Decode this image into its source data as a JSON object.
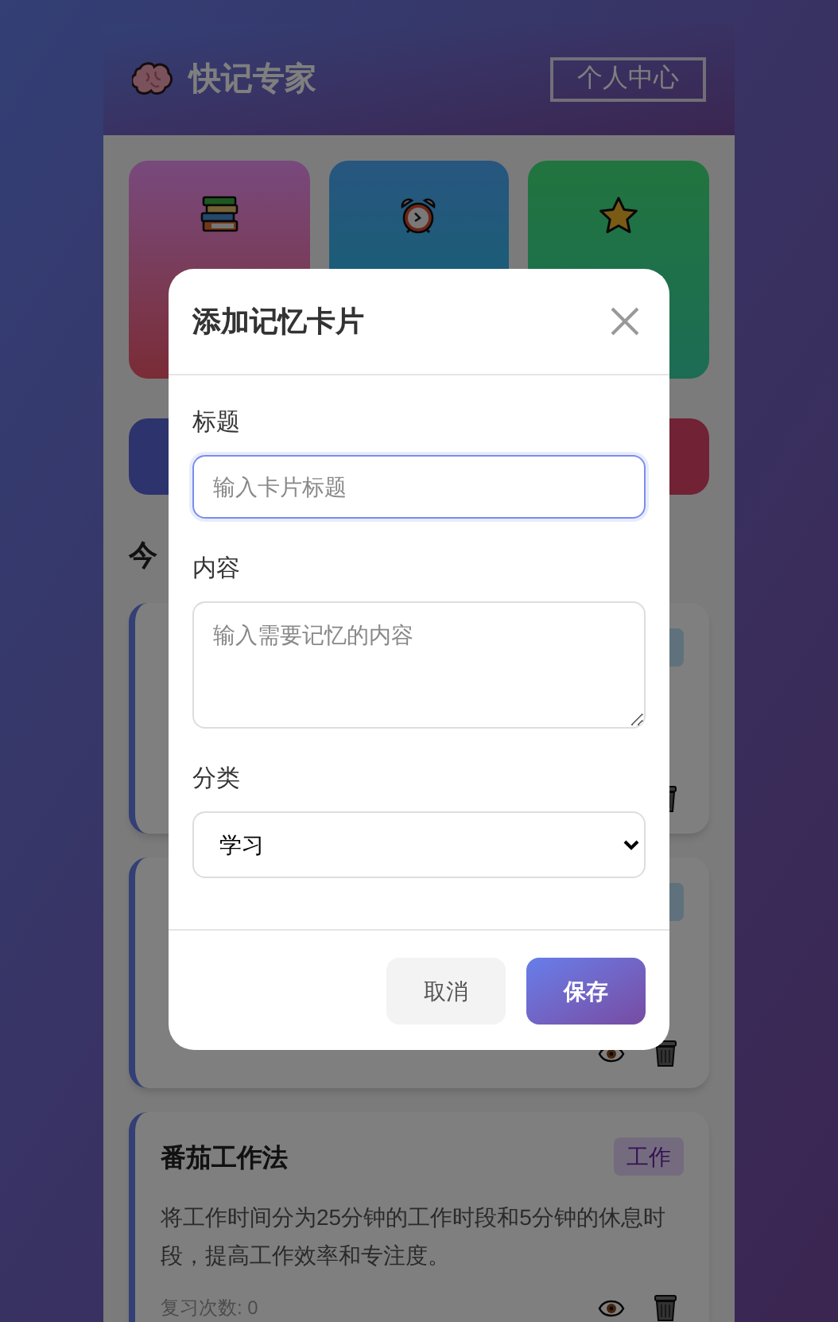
{
  "header": {
    "title": "快记专家",
    "profile_button": "个人中心"
  },
  "stat_cards": [
    {
      "kind": "books"
    },
    {
      "kind": "clock"
    },
    {
      "kind": "star"
    }
  ],
  "action_buttons": [
    {
      "kind": "primary"
    },
    {
      "kind": "danger"
    }
  ],
  "section_title": "今",
  "cards": [
    {
      "kind": "info"
    },
    {
      "kind": "info"
    },
    {
      "title": "番茄工作法",
      "tag": "工作",
      "kind": "accent",
      "description": "将工作时间分为25分钟的工作时段和5分钟的休息时段，提高工作效率和专注度。",
      "review_count": "复习次数: 0"
    }
  ],
  "modal": {
    "title": "添加记忆卡片",
    "fields": [
      {
        "kind": "input",
        "label": "标题",
        "placeholder": "输入卡片标题",
        "focused": true
      },
      {
        "kind": "textarea",
        "label": "内容",
        "placeholder": "输入需要记忆的内容",
        "focused": false
      },
      {
        "kind": "select",
        "label": "分类",
        "value": "学习",
        "focused": false
      }
    ],
    "buttons": [
      {
        "kind": "secondary",
        "label": "取消"
      },
      {
        "kind": "primary",
        "label": "保存"
      }
    ]
  }
}
